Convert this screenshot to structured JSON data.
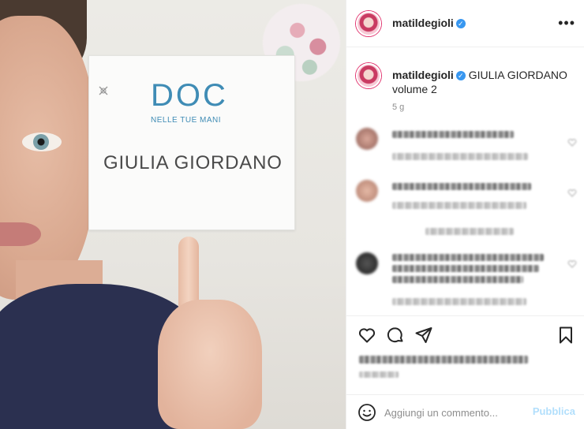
{
  "photo": {
    "sign": {
      "logo_text": "DOC",
      "tagline": "NELLE TUE MANI",
      "name": "GIULIA GIORDANO"
    }
  },
  "post": {
    "username": "matildegioli",
    "verified": true,
    "more_icon": "more-horizontal-icon",
    "caption_username": "matildegioli",
    "caption_text": "GIULIA GIORDANO volume 2",
    "caption_time": "5 g"
  },
  "comments": {
    "blurred": true,
    "middle_link_blurred": true
  },
  "actions": {
    "icons": [
      "heart-icon",
      "comment-icon",
      "share-icon",
      "bookmark-icon"
    ]
  },
  "add_comment": {
    "placeholder": "Aggiungi un commento...",
    "post_label": "Pubblica",
    "emoji_icon": "smile-icon"
  },
  "colors": {
    "accent": "#3897f0",
    "post_button_disabled": "#b2dffc",
    "doc_blue": "#3f8cb5",
    "scrubs": "#2b3050"
  }
}
